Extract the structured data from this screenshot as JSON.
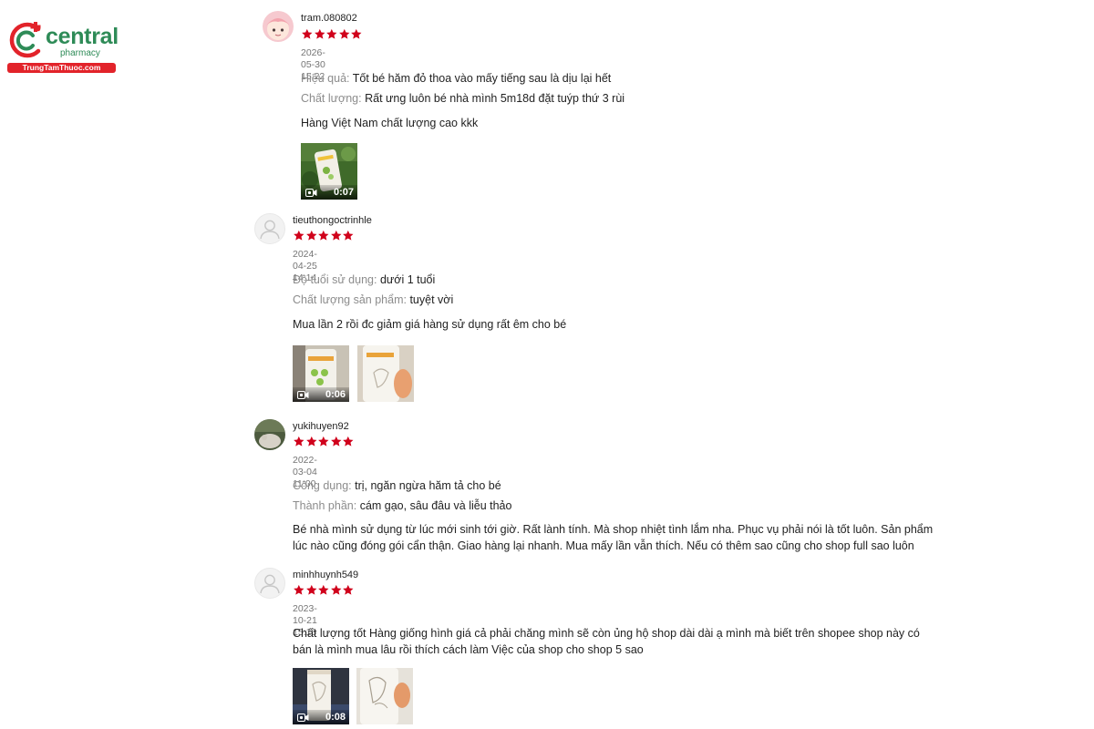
{
  "brand": {
    "name": "central",
    "sub": "pharmacy",
    "url": "TrungTamThuoc.com",
    "colors": {
      "green": "#2e8b57",
      "red": "#e2232a"
    }
  },
  "star_color": "#d0011b",
  "reviews": [
    {
      "username": "tram.080802",
      "rating": 5,
      "date": "2026-05-30 15:22",
      "attributes": [
        {
          "key": "Hiệu quả:",
          "value": "Tốt bé hăm đỏ thoa vào mấy tiếng sau là dịu lại hết"
        },
        {
          "key": "Chất lượng:",
          "value": "Rất ưng luôn bé nhà mình 5m18d đặt tuýp thứ 3 rùi"
        }
      ],
      "comment": "Hàng Việt Nam chất lượng cao kkk",
      "media": [
        {
          "type": "video",
          "duration": "0:07",
          "icon": "video-camera-icon"
        }
      ]
    },
    {
      "username": "tieuthongoctrinhle",
      "rating": 5,
      "date": "2024-04-25 14:14",
      "attributes": [
        {
          "key": "Độ tuổi sử dụng:",
          "value": "dưới 1 tuổi"
        },
        {
          "key": "Chất lượng sản phẩm:",
          "value": "tuyệt vời"
        }
      ],
      "comment": "Mua lần 2 rồi đc giảm giá hàng sử dụng rất êm cho bé",
      "media": [
        {
          "type": "video",
          "duration": "0:06",
          "icon": "video-camera-icon"
        },
        {
          "type": "image"
        }
      ]
    },
    {
      "username": "yukihuyen92",
      "rating": 5,
      "date": "2022-03-04 11:00",
      "attributes": [
        {
          "key": "Công dụng:",
          "value": "trị, ngăn ngừa hăm tả cho bé"
        },
        {
          "key": "Thành phần:",
          "value": "cám gạo, sâu đâu và liễu thảo"
        }
      ],
      "comment": "Bé nhà mình sử dụng từ lúc mới sinh tới giờ. Rất lành tính. Mà shop nhiệt tình lắm nha. Phục vụ phải nói là tốt luôn. Sản phẩm lúc nào cũng đóng gói cẩn thận. Giao hàng lại nhanh. Mua mấy lần vẫn thích. Nếu có thêm sao cũng cho shop full sao luôn",
      "media": []
    },
    {
      "username": "minhhuynh549",
      "rating": 5,
      "date": "2023-10-21 15:16",
      "attributes": [],
      "comment": "Chất lượng tốt Hàng giống hình giá cả phải chăng mình sẽ còn ủng hộ shop dài dài ạ mình mà biết trên shopee shop này có bán là mình mua lâu rồi thích cách làm Việc của shop cho shop 5 sao",
      "media": [
        {
          "type": "video",
          "duration": "0:08",
          "icon": "video-camera-icon"
        },
        {
          "type": "image"
        }
      ]
    }
  ]
}
